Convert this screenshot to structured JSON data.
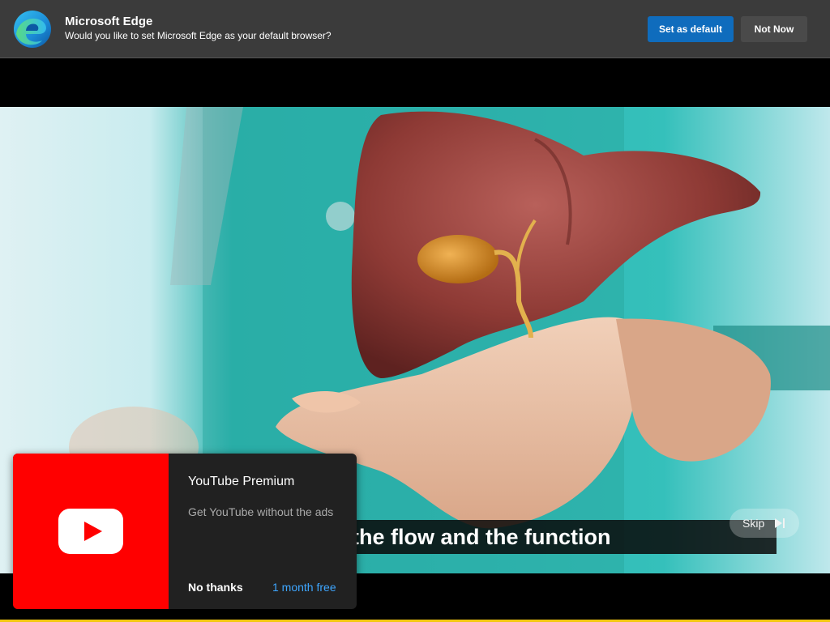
{
  "edge_prompt": {
    "title": "Microsoft Edge",
    "message": "Would you like to set Microsoft Edge as your default browser?",
    "primary_button": "Set as default",
    "secondary_button": "Not Now",
    "logo_icon": "edge-logo-icon",
    "colors": {
      "bar": "#3b3b3b",
      "primary": "#0f6cbd"
    }
  },
  "video": {
    "caption": "the flow and the function",
    "skip_label": "Skip",
    "skip_icon": "skip-next-icon"
  },
  "promo": {
    "title": "YouTube Premium",
    "subtitle": "Get YouTube without the ads",
    "dismiss_label": "No thanks",
    "trial_label": "1 month free",
    "logo_icon": "youtube-play-icon",
    "colors": {
      "brand": "#ff0000",
      "link": "#3ea6ff"
    }
  }
}
